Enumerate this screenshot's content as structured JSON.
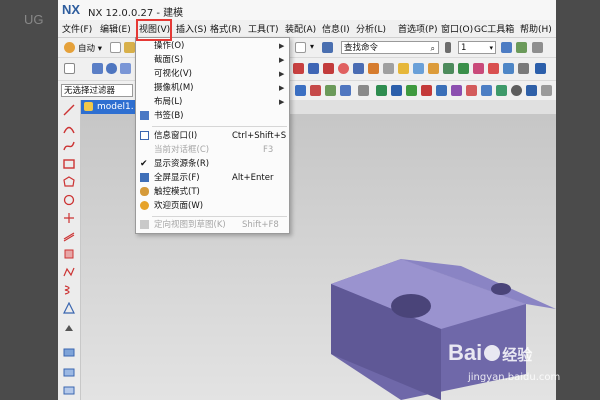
{
  "outer": {
    "label": "UG"
  },
  "window": {
    "logo": "NX",
    "title": "NX 12.0.0.27 - 建模"
  },
  "menubar": {
    "items": [
      "文件(F)",
      "编辑(E)",
      "视图(V)",
      "插入(S)",
      "格式(R)",
      "工具(T)",
      "装配(A)",
      "信息(I)",
      "分析(L)",
      "首选项(P)",
      "窗口(O)",
      "GC工具箱",
      "帮助(H)"
    ]
  },
  "toolbar": {
    "start_label": "自动 ▾",
    "search_placeholder": "查找命令",
    "spin_value": "1",
    "filter_label": "无选择过滤器"
  },
  "tab": {
    "label": "model1."
  },
  "view_menu": {
    "items": [
      {
        "label": "操作(O)",
        "shortcut": "",
        "submenu": true,
        "icon": "",
        "disabled": false
      },
      {
        "label": "截面(S)",
        "shortcut": "",
        "submenu": true,
        "icon": "",
        "disabled": false
      },
      {
        "label": "可视化(V)",
        "shortcut": "",
        "submenu": true,
        "icon": "",
        "disabled": false
      },
      {
        "label": "摄像机(M)",
        "shortcut": "",
        "submenu": true,
        "icon": "",
        "disabled": false
      },
      {
        "label": "布局(L)",
        "shortcut": "",
        "submenu": true,
        "icon": "",
        "disabled": false
      },
      {
        "label": "书签(B)",
        "shortcut": "",
        "submenu": false,
        "icon": "bookmark-icon",
        "disabled": false
      },
      {
        "label": "信息窗口(I)",
        "shortcut": "Ctrl+Shift+S",
        "submenu": false,
        "icon": "info-window-icon",
        "disabled": false
      },
      {
        "label": "当前对话框(C)",
        "shortcut": "F3",
        "submenu": false,
        "icon": "",
        "disabled": true
      },
      {
        "label": "显示资源条(R)",
        "shortcut": "",
        "submenu": false,
        "icon": "check-icon",
        "disabled": false
      },
      {
        "label": "全屏显示(F)",
        "shortcut": "Alt+Enter",
        "submenu": false,
        "icon": "fullscreen-icon",
        "disabled": false
      },
      {
        "label": "触控模式(T)",
        "shortcut": "",
        "submenu": false,
        "icon": "touch-mode-icon",
        "disabled": false
      },
      {
        "label": "欢迎页面(W)",
        "shortcut": "",
        "submenu": false,
        "icon": "welcome-page-icon",
        "disabled": false
      },
      {
        "label": "定向视图到草图(K)",
        "shortcut": "Shift+F8",
        "submenu": false,
        "icon": "orient-view-icon",
        "disabled": true
      }
    ]
  },
  "watermark": {
    "brand": "Bai",
    "brand_cn": "经验",
    "url": "jingyan.baidu.com"
  },
  "colors": {
    "accent": "#2e6fd1",
    "highlight": "#e53935",
    "part": "#7b73b8"
  }
}
